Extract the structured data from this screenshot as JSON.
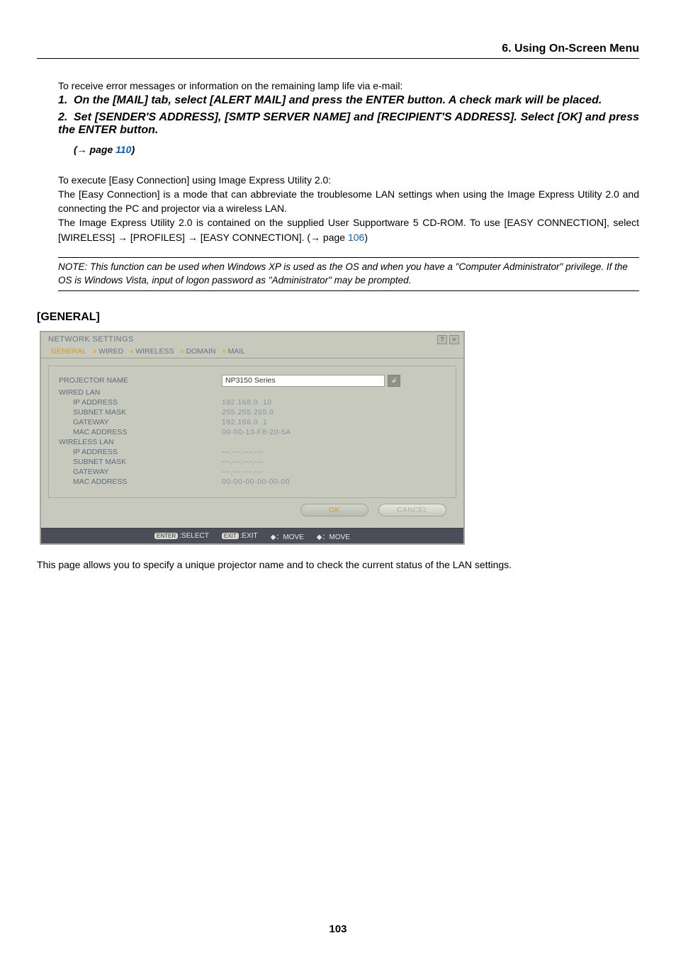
{
  "section_header": "6. Using On-Screen Menu",
  "intro_line": "To receive error messages or information on the remaining lamp life via e-mail:",
  "steps": [
    "On the [MAIL] tab, select [ALERT MAIL] and press the ENTER button. A check mark will be placed.",
    "Set [SENDER'S ADDRESS], [SMTP SERVER NAME] and [RECIPIENT'S ADDRESS]. Select [OK] and press the ENTER button."
  ],
  "page_ref_prefix": "(→ page ",
  "page_ref_link": "110",
  "page_ref_suffix": ")",
  "exec_heading": "To execute [Easy Connection] using Image Express Utility 2.0:",
  "exec_para1": "The [Easy Connection] is a mode that can abbreviate the troublesome LAN settings when using the Image Express Utility 2.0 and connecting the PC and projector via a wireless LAN.",
  "exec_para2_a": "The Image Express Utility 2.0 is contained on the supplied User Supportware 5 CD-ROM. To use [EASY CONNECTION], select [WIRELESS] → [PROFILES] → [EASY CONNECTION]. (→ page ",
  "exec_para2_link": "106",
  "exec_para2_b": ")",
  "note_text": "NOTE: This function can be used when Windows XP is used as the OS and when you have a \"Computer Administrator\" privilege. If the OS is Windows Vista, input of logon password as \"Administrator\" may be prompted.",
  "general_heading": "[GENERAL]",
  "dialog": {
    "title": "NETWORK SETTINGS",
    "tabs": [
      "GENERAL",
      "WIRED",
      "WIRELESS",
      "DOMAIN",
      "MAIL"
    ],
    "rows": {
      "projector_name_label": "PROJECTOR NAME",
      "projector_name_value": "NP3150 Series",
      "wired_lan": "WIRED LAN",
      "wired_ip_label": "IP ADDRESS",
      "wired_ip_value": "192.168.0 .10",
      "wired_subnet_label": "SUBNET MASK",
      "wired_subnet_value": "255.255.255.0",
      "wired_gateway_label": "GATEWAY",
      "wired_gateway_value": "192.168.0 .1",
      "wired_mac_label": "MAC ADDRESS",
      "wired_mac_value": "00-00-13-F8-20-5A",
      "wireless_lan": "WIRELESS LAN",
      "wireless_ip_label": "IP ADDRESS",
      "wireless_ip_value": "---.---.---.---",
      "wireless_subnet_label": "SUBNET MASK",
      "wireless_subnet_value": "---.---.---.---",
      "wireless_gateway_label": "GATEWAY",
      "wireless_gateway_value": "---.---.---.---",
      "wireless_mac_label": "MAC ADDRESS",
      "wireless_mac_value": "00-00-00-00-00-00"
    },
    "ok": "OK",
    "cancel": "CANCEL",
    "footer": {
      "enter_key": "ENTER",
      "enter_lbl": ":SELECT",
      "exit_key": "EXIT",
      "exit_lbl": ":EXIT",
      "move1": "：MOVE",
      "move2": "：MOVE"
    }
  },
  "after_dialog": "This page allows you to specify a unique projector name and to check the current status of the LAN settings.",
  "page_number": "103"
}
